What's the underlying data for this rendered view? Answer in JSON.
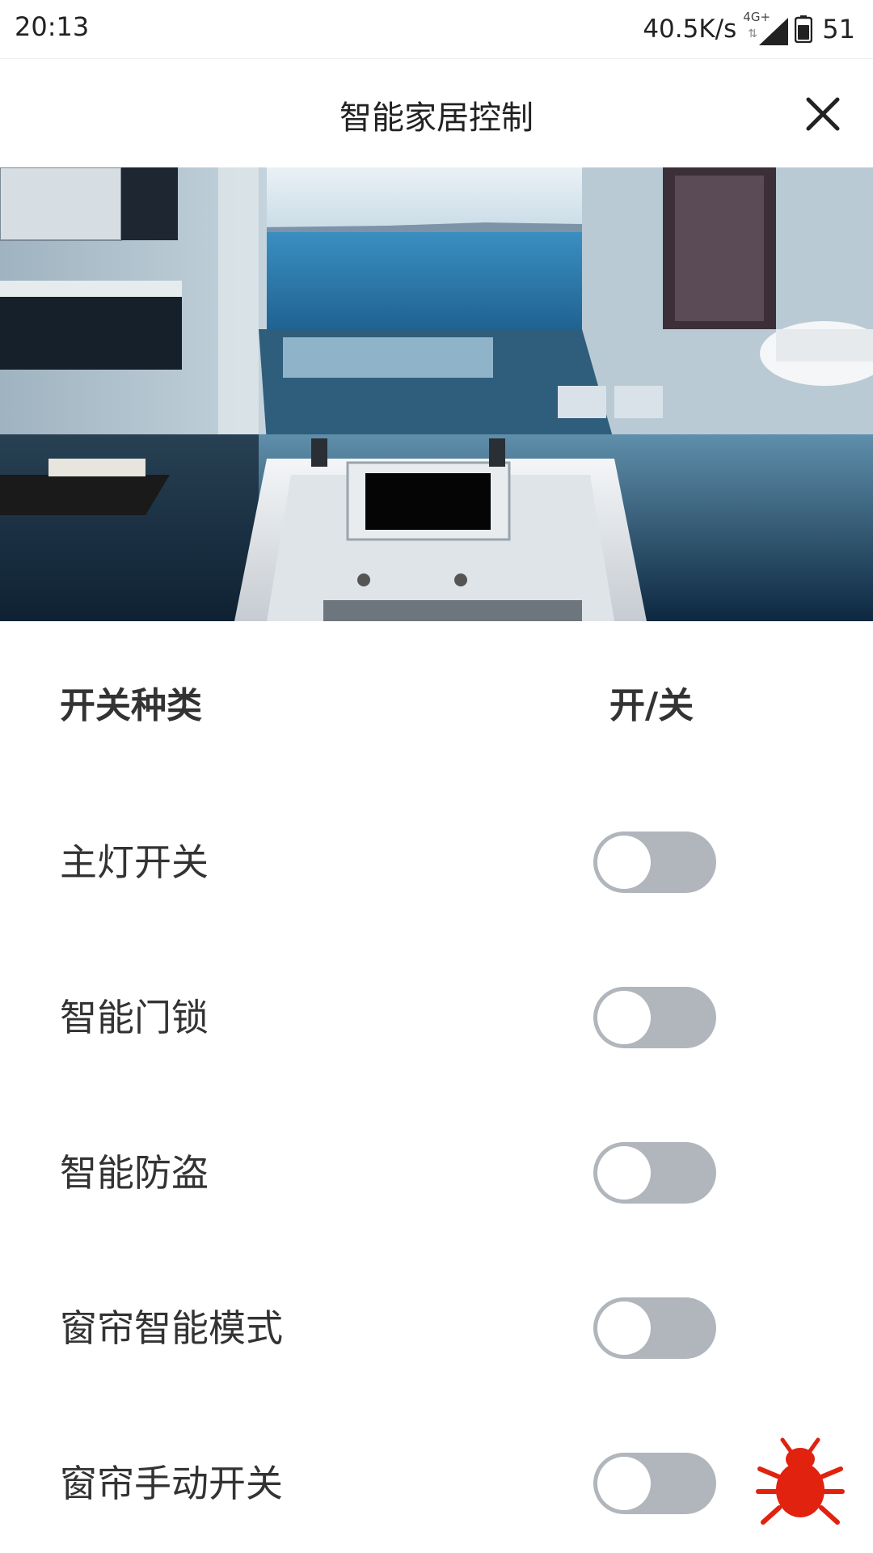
{
  "status_bar": {
    "time": "20:13",
    "speed": "40.5K/s",
    "network_type": "4G+",
    "battery_level": "51"
  },
  "header": {
    "title": "智能家居控制",
    "close_icon": "close-icon"
  },
  "banner": {
    "image": "bathroom-interior-photo"
  },
  "table": {
    "col_type": "开关种类",
    "col_state": "开/关"
  },
  "switches": [
    {
      "label": "主灯开关",
      "on": false
    },
    {
      "label": "智能门锁",
      "on": false
    },
    {
      "label": "智能防盗",
      "on": false
    },
    {
      "label": "窗帘智能模式",
      "on": false
    },
    {
      "label": "窗帘手动开关",
      "on": false
    }
  ],
  "fab": {
    "icon": "bug-icon",
    "color": "#e0220f"
  },
  "colors": {
    "toggle_off": "#b0b6bb",
    "background": "#ffffff"
  }
}
